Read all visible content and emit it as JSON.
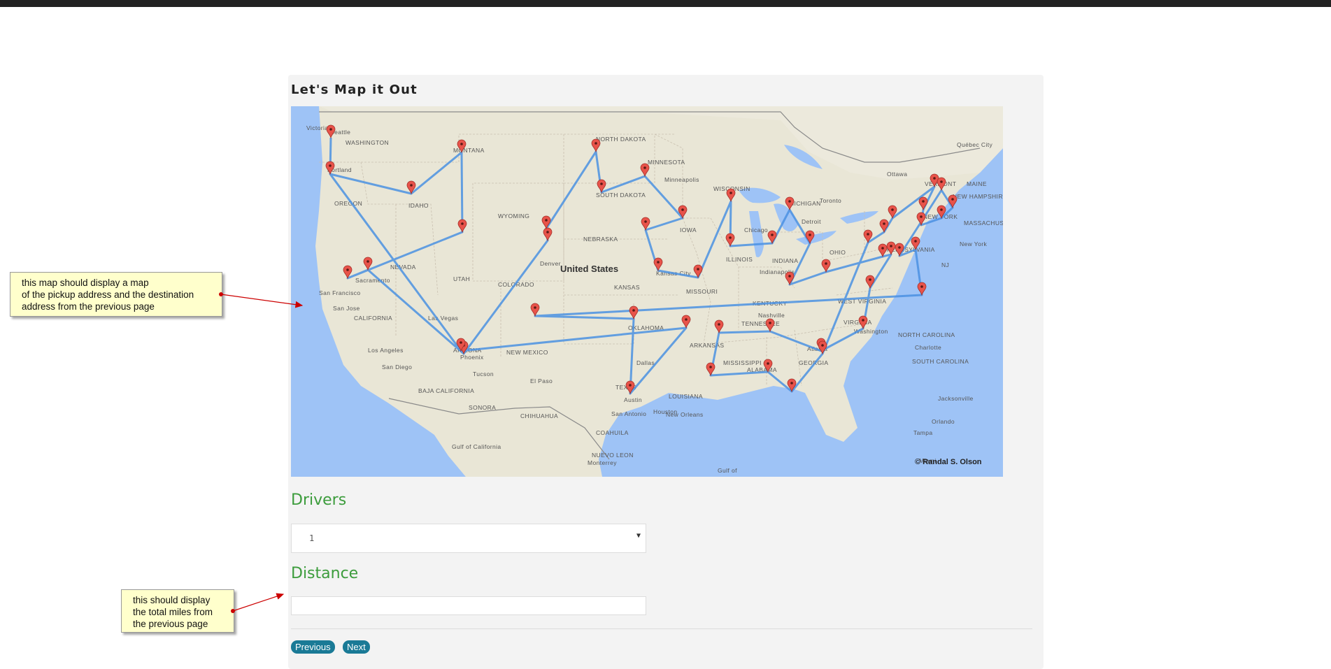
{
  "page": {
    "title": "Let's Map it Out"
  },
  "map": {
    "attribution": "© Randal S. Olson",
    "country_label": "United States",
    "labels": [
      "Victoria",
      "Seattle",
      "WASHINGTON",
      "Portland",
      "OREGON",
      "IDAHO",
      "MONTANA",
      "NORTH DAKOTA",
      "MINNESOTA",
      "Minneapolis",
      "SOUTH DAKOTA",
      "WISCONSIN",
      "WYOMING",
      "NEBRASKA",
      "IOWA",
      "MICHIGAN",
      "Detroit",
      "Toronto",
      "Ottawa",
      "Québec City",
      "VERMONT",
      "MAINE",
      "NEW YORK",
      "NEW HAMPSHIRE",
      "MASSACHUSETTS",
      "PENNSYLVANIA",
      "New York",
      "NJ",
      "OHIO",
      "Chicago",
      "ILLINOIS",
      "INDIANA",
      "Indianapolis",
      "NEVADA",
      "UTAH",
      "Denver",
      "COLORADO",
      "KANSAS",
      "Kansas City",
      "MISSOURI",
      "KENTUCKY",
      "WEST VIRGINIA",
      "VIRGINIA",
      "Washington",
      "San Francisco",
      "Sacramento",
      "San Jose",
      "CALIFORNIA",
      "Las Vegas",
      "Los Angeles",
      "San Diego",
      "ARIZONA",
      "Phoenix",
      "Tucson",
      "NEW MEXICO",
      "OKLAHOMA",
      "ARKANSAS",
      "TENNESSEE",
      "Nashville",
      "NORTH CAROLINA",
      "Charlotte",
      "SOUTH CAROLINA",
      "GEORGIA",
      "Atlanta",
      "ALABAMA",
      "MISSISSIPPI",
      "LOUISIANA",
      "New Orleans",
      "TEXAS",
      "Dallas",
      "Austin",
      "San Antonio",
      "Houston",
      "El Paso",
      "Jacksonville",
      "Orlando",
      "Tampa",
      "Miami",
      "BAJA CALIFORNIA",
      "SONORA",
      "CHIHUAHUA",
      "COAHUILA",
      "NUEVO LEON",
      "Monterrey",
      "Gulf of California",
      "Gulf of"
    ]
  },
  "drivers": {
    "label": "Drivers",
    "selected": "1"
  },
  "distance": {
    "label": "Distance",
    "value": ""
  },
  "buttons": {
    "previous": "Previous",
    "next": "Next"
  },
  "annotations": {
    "map_note": "this map should display a map\nof the pickup address and the destination\naddress from the previous page",
    "distance_note": "this should display\nthe total miles from\nthe previous page"
  },
  "colors": {
    "route": "#4a90e2",
    "pin": "#e8534a",
    "label_green": "#3c9c3c",
    "button": "#1a7a96",
    "note_bg": "#ffffcc"
  }
}
